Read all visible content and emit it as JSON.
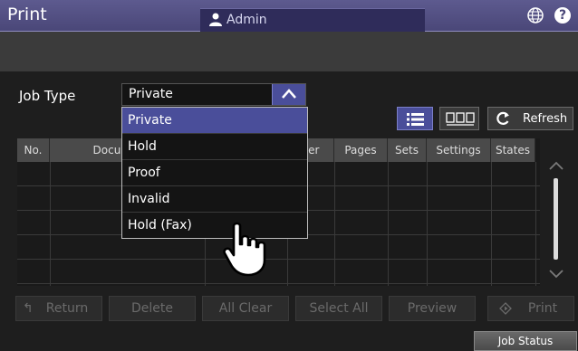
{
  "header": {
    "title": "Print",
    "user": "Admin"
  },
  "job_type": {
    "label": "Job Type",
    "selected": "Private",
    "options": [
      "Private",
      "Hold",
      "Proof",
      "Invalid",
      "Hold (Fax)"
    ]
  },
  "toolbar": {
    "refresh_label": "Refresh"
  },
  "table": {
    "columns": [
      "No.",
      "Docum",
      "per",
      "Pages",
      "Sets",
      "Settings",
      "States"
    ]
  },
  "actions": {
    "return": "Return",
    "delete": "Delete",
    "all_clear": "All Clear",
    "select_all": "Select All",
    "preview": "Preview",
    "print": "Print"
  },
  "status": {
    "job_status": "Job Status"
  },
  "colors": {
    "accent": "#4a4e9a",
    "title_bar": "#4a4778"
  }
}
